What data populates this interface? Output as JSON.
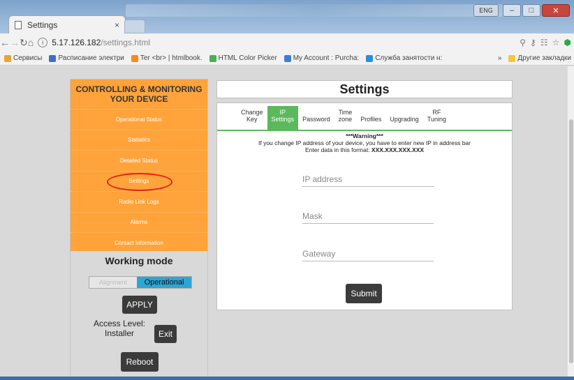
{
  "browser": {
    "tab_title": "Settings",
    "tab_close": "×",
    "address_host": "5.17.126.182",
    "address_path": "/settings.html",
    "language_badge": "ENG",
    "bookmarks": [
      {
        "label": "Сервисы",
        "color": "#e8a33a"
      },
      {
        "label": "Расписание электри",
        "color": "#3b6fc9"
      },
      {
        "label": "Ter <br> | htmlbook.",
        "color": "#f28c1e"
      },
      {
        "label": "HTML Color Picker",
        "color": "#4caf50"
      },
      {
        "label": "My Account : Purcha:",
        "color": "#3f7fd1"
      },
      {
        "label": "Служба занятости н:",
        "color": "#2b8fd6"
      }
    ],
    "other_bookmarks": "Другие закладки",
    "overflow": "»"
  },
  "sidebar": {
    "heading_line1": "CONTROLLING & MONITORING",
    "heading_line2": "YOUR DEVICE",
    "items": [
      {
        "label": "Operational Status"
      },
      {
        "label": "Statistics"
      },
      {
        "label": "Detailed Status"
      },
      {
        "label": "Settings"
      },
      {
        "label": "Radio Link Logs"
      },
      {
        "label": "Alarms"
      },
      {
        "label": "Contact Information"
      }
    ],
    "working_mode": "Working mode",
    "mode_options": [
      "Alignment",
      "Operational"
    ],
    "apply_label": "APPLY",
    "access_level_line1": "Access Level:",
    "access_level_line2": "Installer",
    "exit_label": "Exit",
    "reboot_label": "Reboot"
  },
  "settings": {
    "title": "Settings",
    "tabs": [
      {
        "line1": "Change",
        "line2": "Key"
      },
      {
        "line1": "IP",
        "line2": "Settings"
      },
      {
        "line1": "",
        "line2": "Password"
      },
      {
        "line1": "Time",
        "line2": "zone"
      },
      {
        "line1": "",
        "line2": "Profiles"
      },
      {
        "line1": "",
        "line2": "Upgrading"
      },
      {
        "line1": "RF",
        "line2": "Tuning"
      }
    ],
    "warning_title": "***Warning***",
    "warning_line1": "If you change IP address of your device, you have to enter new IP in address bar",
    "warning_line2_prefix": "Enter data in this format: ",
    "warning_format": "XXX.XXX.XXX.XXX",
    "ip_placeholder": "IP address",
    "mask_placeholder": "Mask",
    "gateway_placeholder": "Gateway",
    "submit_label": "Submit"
  },
  "colors": {
    "sidebar_bg": "#ffa33a",
    "active_tab": "#5cb85c",
    "highlight_oval": "#e0201b",
    "toggle_active": "#2da6d6"
  }
}
